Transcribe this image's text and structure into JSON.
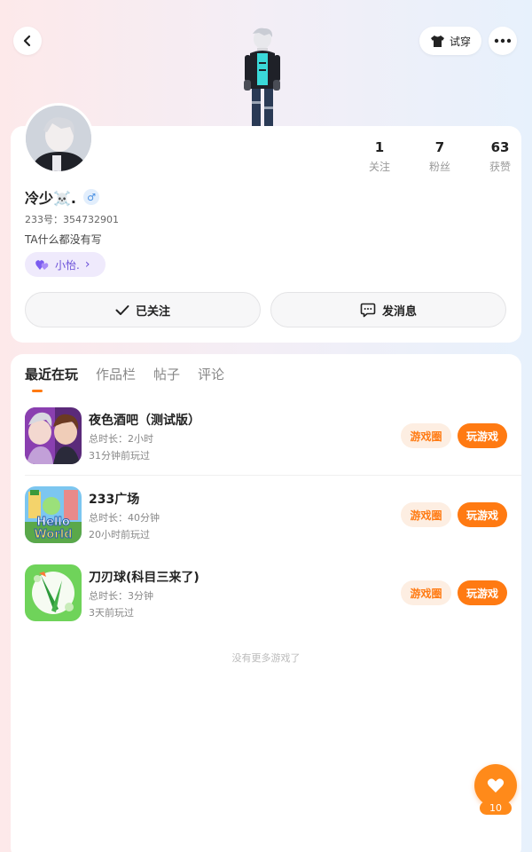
{
  "header": {
    "tryon_label": "试穿",
    "back_icon": "back-arrow-icon",
    "more_icon": "more-dots-icon",
    "tryon_icon": "tshirt-icon"
  },
  "profile": {
    "name": "冷少☠️.",
    "gender_symbol": "♂",
    "uid": "233号：354732901",
    "bio": "TA什么都没有写",
    "tag_label": "小怡.",
    "tag_chevron": "›",
    "stats": [
      {
        "value": "1",
        "label": "关注"
      },
      {
        "value": "7",
        "label": "粉丝"
      },
      {
        "value": "63",
        "label": "获赞"
      }
    ],
    "follow_label": "已关注",
    "message_label": "发消息"
  },
  "tabs": [
    "最近在玩",
    "作品栏",
    "帖子",
    "评论"
  ],
  "games": [
    {
      "name": "夜色酒吧（测试版）",
      "duration": "总时长：2小时",
      "last_played": "31分钟前玩过",
      "circle_label": "游戏圈",
      "play_label": "玩游戏"
    },
    {
      "name": "233广场",
      "duration": "总时长：40分钟",
      "last_played": "20小时前玩过",
      "circle_label": "游戏圈",
      "play_label": "玩游戏"
    },
    {
      "name": "刀刃球(科目三来了)",
      "duration": "总时长：3分钟",
      "last_played": "3天前玩过",
      "circle_label": "游戏圈",
      "play_label": "玩游戏"
    }
  ],
  "game_icon_texts": {
    "hello": "Hello",
    "world": "World"
  },
  "no_more_text": "没有更多游戏了",
  "like": {
    "count": "10"
  },
  "colors": {
    "accent": "#ff7a12",
    "tag": "#6a4fd8"
  }
}
